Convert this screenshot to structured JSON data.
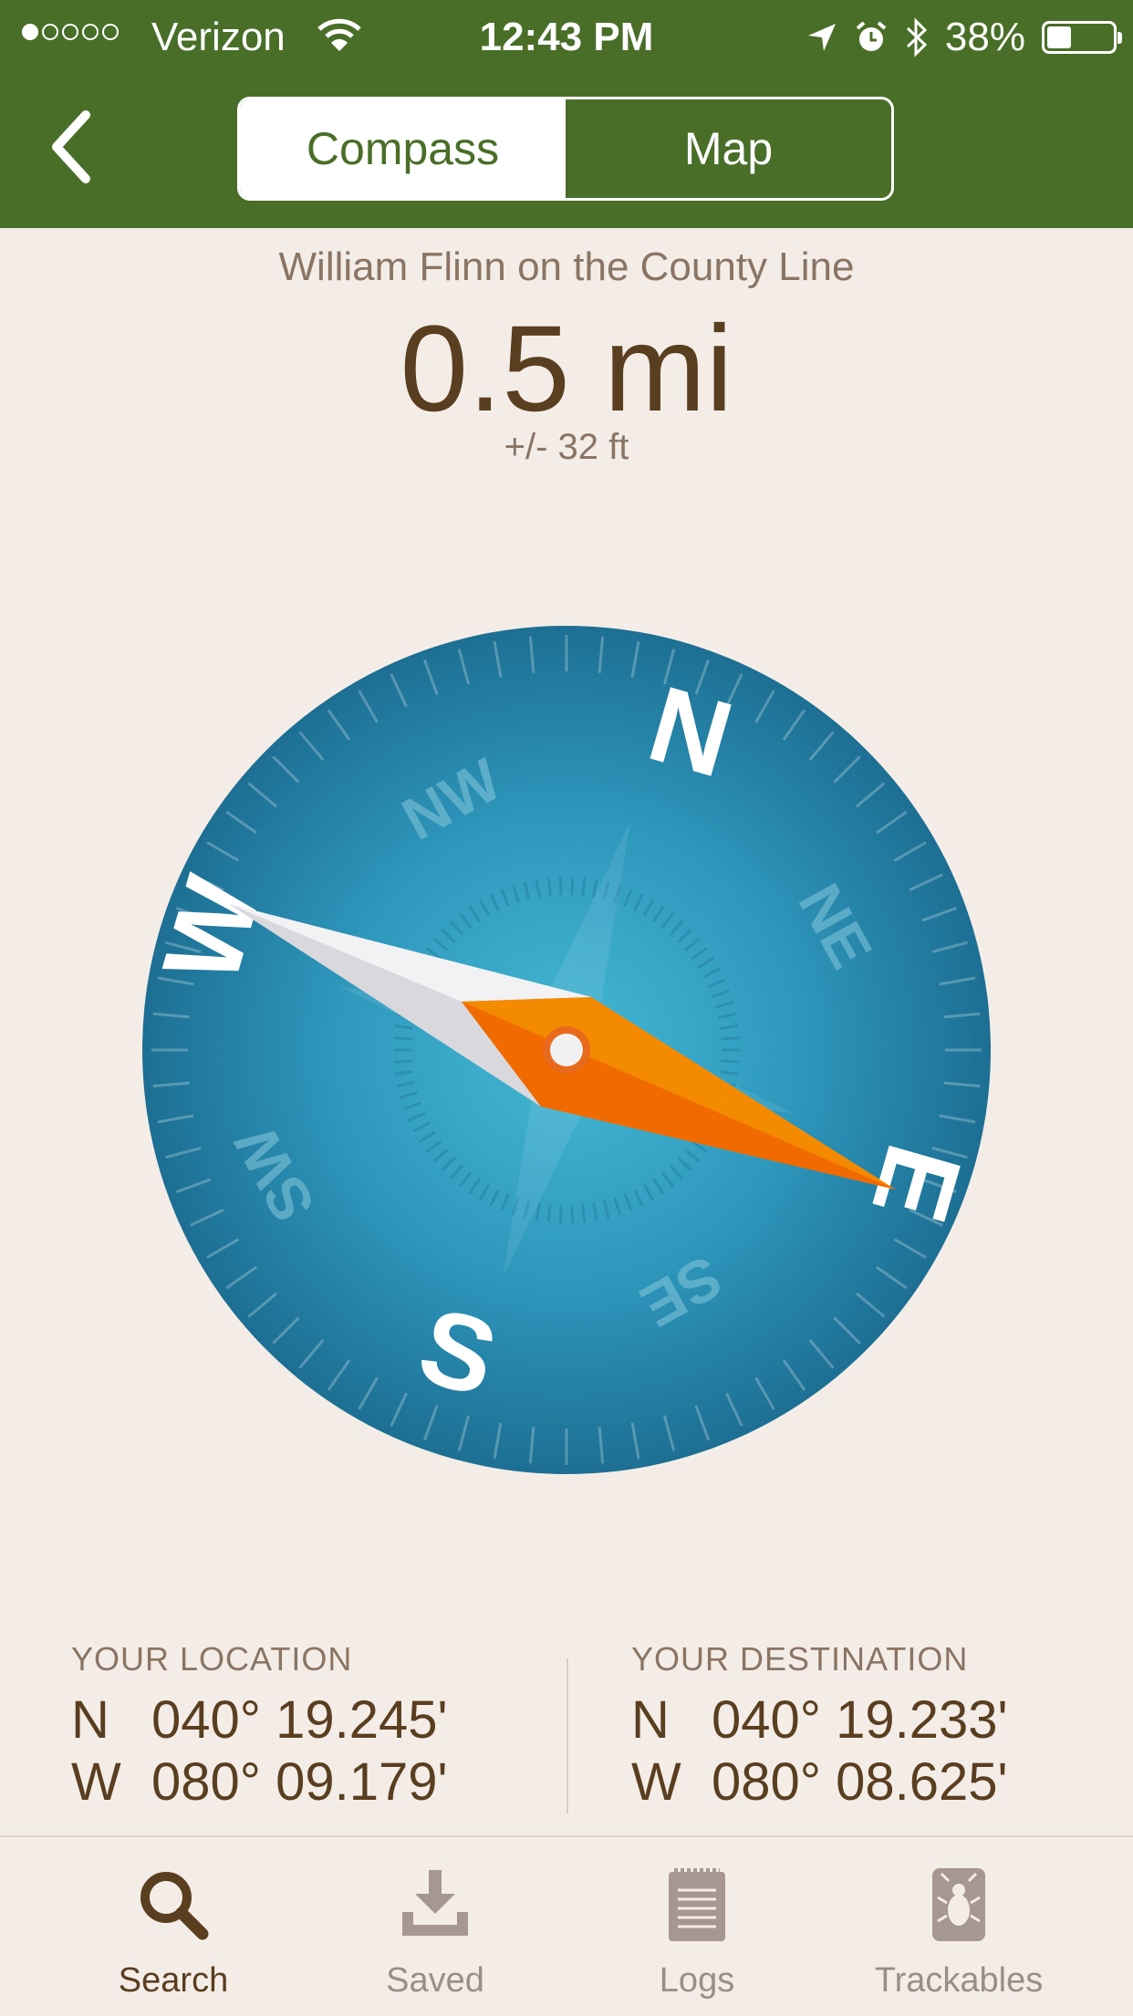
{
  "status_bar": {
    "carrier": "Verizon",
    "time": "12:43 PM",
    "battery": "38%",
    "signal_bars_filled": 1,
    "signal_bars_total": 5
  },
  "nav": {
    "segments": [
      {
        "label": "Compass",
        "active": true
      },
      {
        "label": "Map",
        "active": false
      }
    ]
  },
  "cache": {
    "name": "William Flinn on the County Line",
    "distance": "0.5 mi",
    "accuracy": "+/- 32 ft"
  },
  "compass": {
    "cardinals": {
      "n": "N",
      "s": "S",
      "e": "E",
      "w": "W"
    },
    "intercardinals": {
      "nw": "NW",
      "ne": "NE",
      "sw": "SW",
      "se": "SE"
    },
    "colors": {
      "dial": "#2a8db0",
      "needle": "#f47a00",
      "needle_tail": "#e9e9ec"
    }
  },
  "your_location": {
    "label": "YOUR LOCATION",
    "lat_hemi": "N",
    "lat": "040° 19.245'",
    "lon_hemi": "W",
    "lon": "080° 09.179'"
  },
  "your_destination": {
    "label": "YOUR DESTINATION",
    "lat_hemi": "N",
    "lat": "040° 19.233'",
    "lon_hemi": "W",
    "lon": "080° 08.625'"
  },
  "tabs": [
    {
      "label": "Search",
      "icon": "search-icon",
      "active": true
    },
    {
      "label": "Saved",
      "icon": "download-icon",
      "active": false
    },
    {
      "label": "Logs",
      "icon": "notepad-icon",
      "active": false
    },
    {
      "label": "Trackables",
      "icon": "bug-icon",
      "active": false
    }
  ],
  "theme": {
    "header_green": "#496e28",
    "background": "#f4ede7",
    "text_brown": "#5a3e20"
  }
}
